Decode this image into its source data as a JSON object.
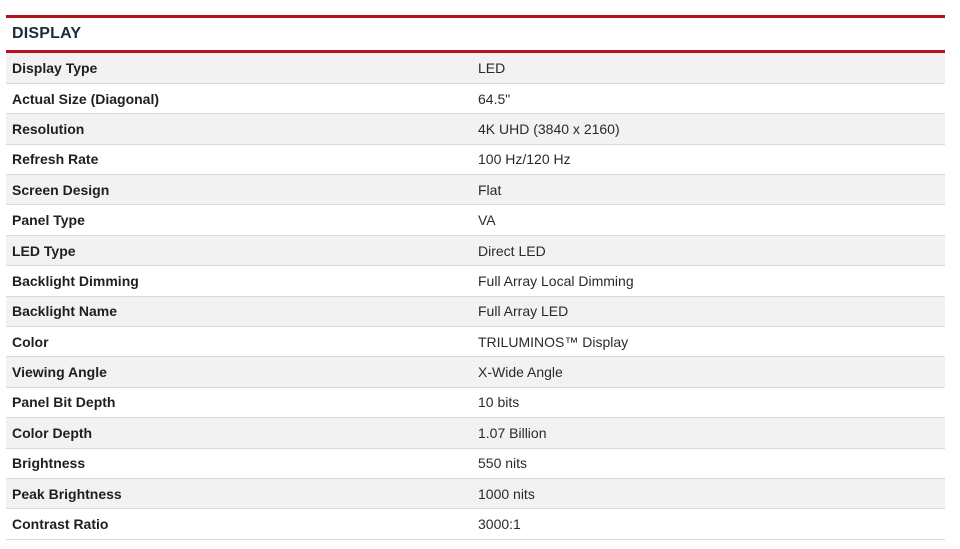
{
  "section": {
    "title": "DISPLAY",
    "accent_color": "#b5121b"
  },
  "specs": [
    {
      "label": "Display Type",
      "value": "LED"
    },
    {
      "label": "Actual Size (Diagonal)",
      "value": "64.5\""
    },
    {
      "label": "Resolution",
      "value": "4K UHD (3840 x 2160)"
    },
    {
      "label": "Refresh Rate",
      "value": "100 Hz/120 Hz"
    },
    {
      "label": "Screen Design",
      "value": "Flat"
    },
    {
      "label": "Panel Type",
      "value": "VA"
    },
    {
      "label": "LED Type",
      "value": "Direct LED"
    },
    {
      "label": "Backlight Dimming",
      "value": "Full Array Local Dimming"
    },
    {
      "label": "Backlight Name",
      "value": "Full Array LED"
    },
    {
      "label": "Color",
      "value": "TRILUMINOS™ Display"
    },
    {
      "label": "Viewing Angle",
      "value": "X-Wide Angle"
    },
    {
      "label": "Panel Bit Depth",
      "value": "10 bits"
    },
    {
      "label": "Color Depth",
      "value": "1.07 Billion"
    },
    {
      "label": "Brightness",
      "value": "550 nits"
    },
    {
      "label": "Peak Brightness",
      "value": "1000 nits"
    },
    {
      "label": "Contrast Ratio",
      "value": "3000:1"
    }
  ]
}
